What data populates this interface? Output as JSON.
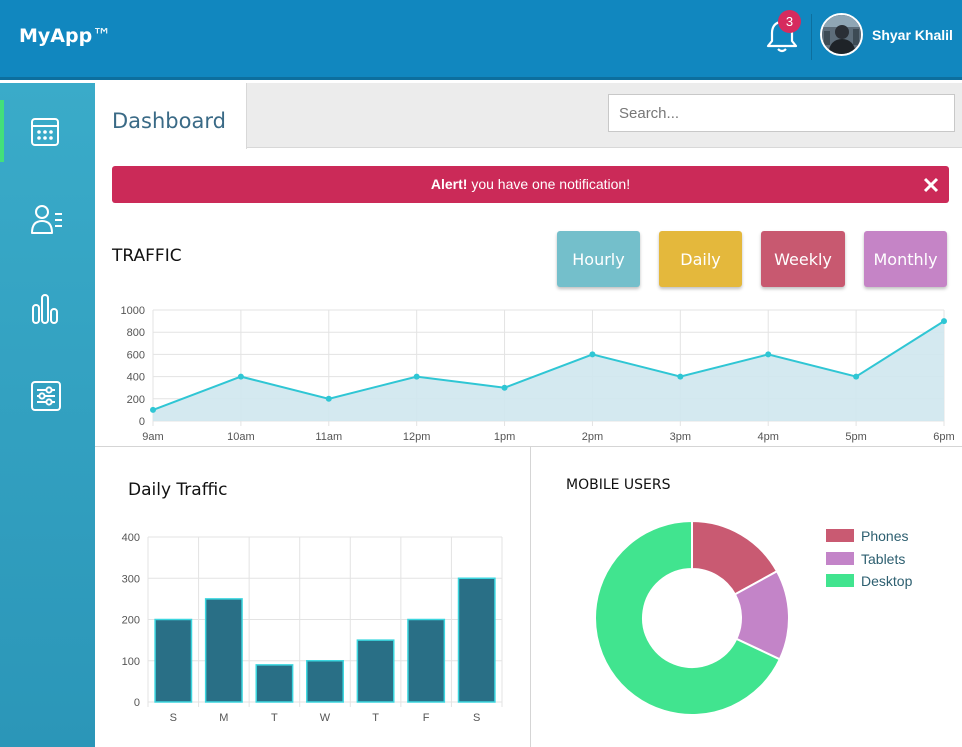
{
  "header": {
    "logo_main": "MyApp",
    "logo_suffix": "™",
    "notification_count": "3",
    "user_name": "Shyar Khalil",
    "colors": {
      "bar": "#1187bf",
      "badge": "#d62b5e"
    }
  },
  "sidebar": {
    "items": [
      {
        "name": "calendar",
        "icon": "calendar-icon",
        "active": true
      },
      {
        "name": "users",
        "icon": "user-list-icon",
        "active": false
      },
      {
        "name": "stats",
        "icon": "bar-stats-icon",
        "active": false
      },
      {
        "name": "settings",
        "icon": "sliders-icon",
        "active": false
      }
    ],
    "active_accent": "#43e07a"
  },
  "main": {
    "tab_label": "Dashboard",
    "search_placeholder": "Search...",
    "alert": {
      "strong": "Alert!",
      "text": " you have one notification!",
      "color": "#cb2a58"
    },
    "traffic_title": "TRAFFIC",
    "traffic_buttons": [
      {
        "label": "Hourly",
        "color": "#74bfcb"
      },
      {
        "label": "Daily",
        "color": "#e4b83c"
      },
      {
        "label": "Weekly",
        "color": "#c85970"
      },
      {
        "label": "Monthly",
        "color": "#c584c6"
      }
    ],
    "daily_title": "Daily Traffic",
    "mobile_title": "MOBILE USERS"
  },
  "chart_data": [
    {
      "type": "area",
      "title": "TRAFFIC",
      "x": [
        "9am",
        "10am",
        "11am",
        "12pm",
        "1pm",
        "2pm",
        "3pm",
        "4pm",
        "5pm",
        "6pm"
      ],
      "series": [
        {
          "values": [
            100,
            400,
            200,
            400,
            300,
            600,
            400,
            600,
            400,
            900
          ]
        }
      ],
      "ylim": [
        0,
        1000
      ],
      "yticks": [
        0,
        200,
        400,
        600,
        800,
        1000
      ],
      "grid": true,
      "colors": {
        "line": "#2fc6d4",
        "fill": "#cfe7ee"
      }
    },
    {
      "type": "bar",
      "title": "Daily Traffic",
      "categories": [
        "S",
        "M",
        "T",
        "W",
        "T",
        "F",
        "S"
      ],
      "values": [
        200,
        250,
        90,
        100,
        150,
        200,
        300
      ],
      "ylim": [
        0,
        400
      ],
      "yticks": [
        0,
        100,
        200,
        300,
        400
      ],
      "grid": true,
      "colors": {
        "bar": "#296f86",
        "border": "#3bd6df"
      }
    },
    {
      "type": "pie",
      "title": "MOBILE USERS",
      "donut": true,
      "labels": [
        "Phones",
        "Tablets",
        "Desktop"
      ],
      "values": [
        17,
        15,
        68
      ],
      "colors": [
        "#c95a72",
        "#c384c8",
        "#41e48f"
      ],
      "legend": "right"
    }
  ]
}
